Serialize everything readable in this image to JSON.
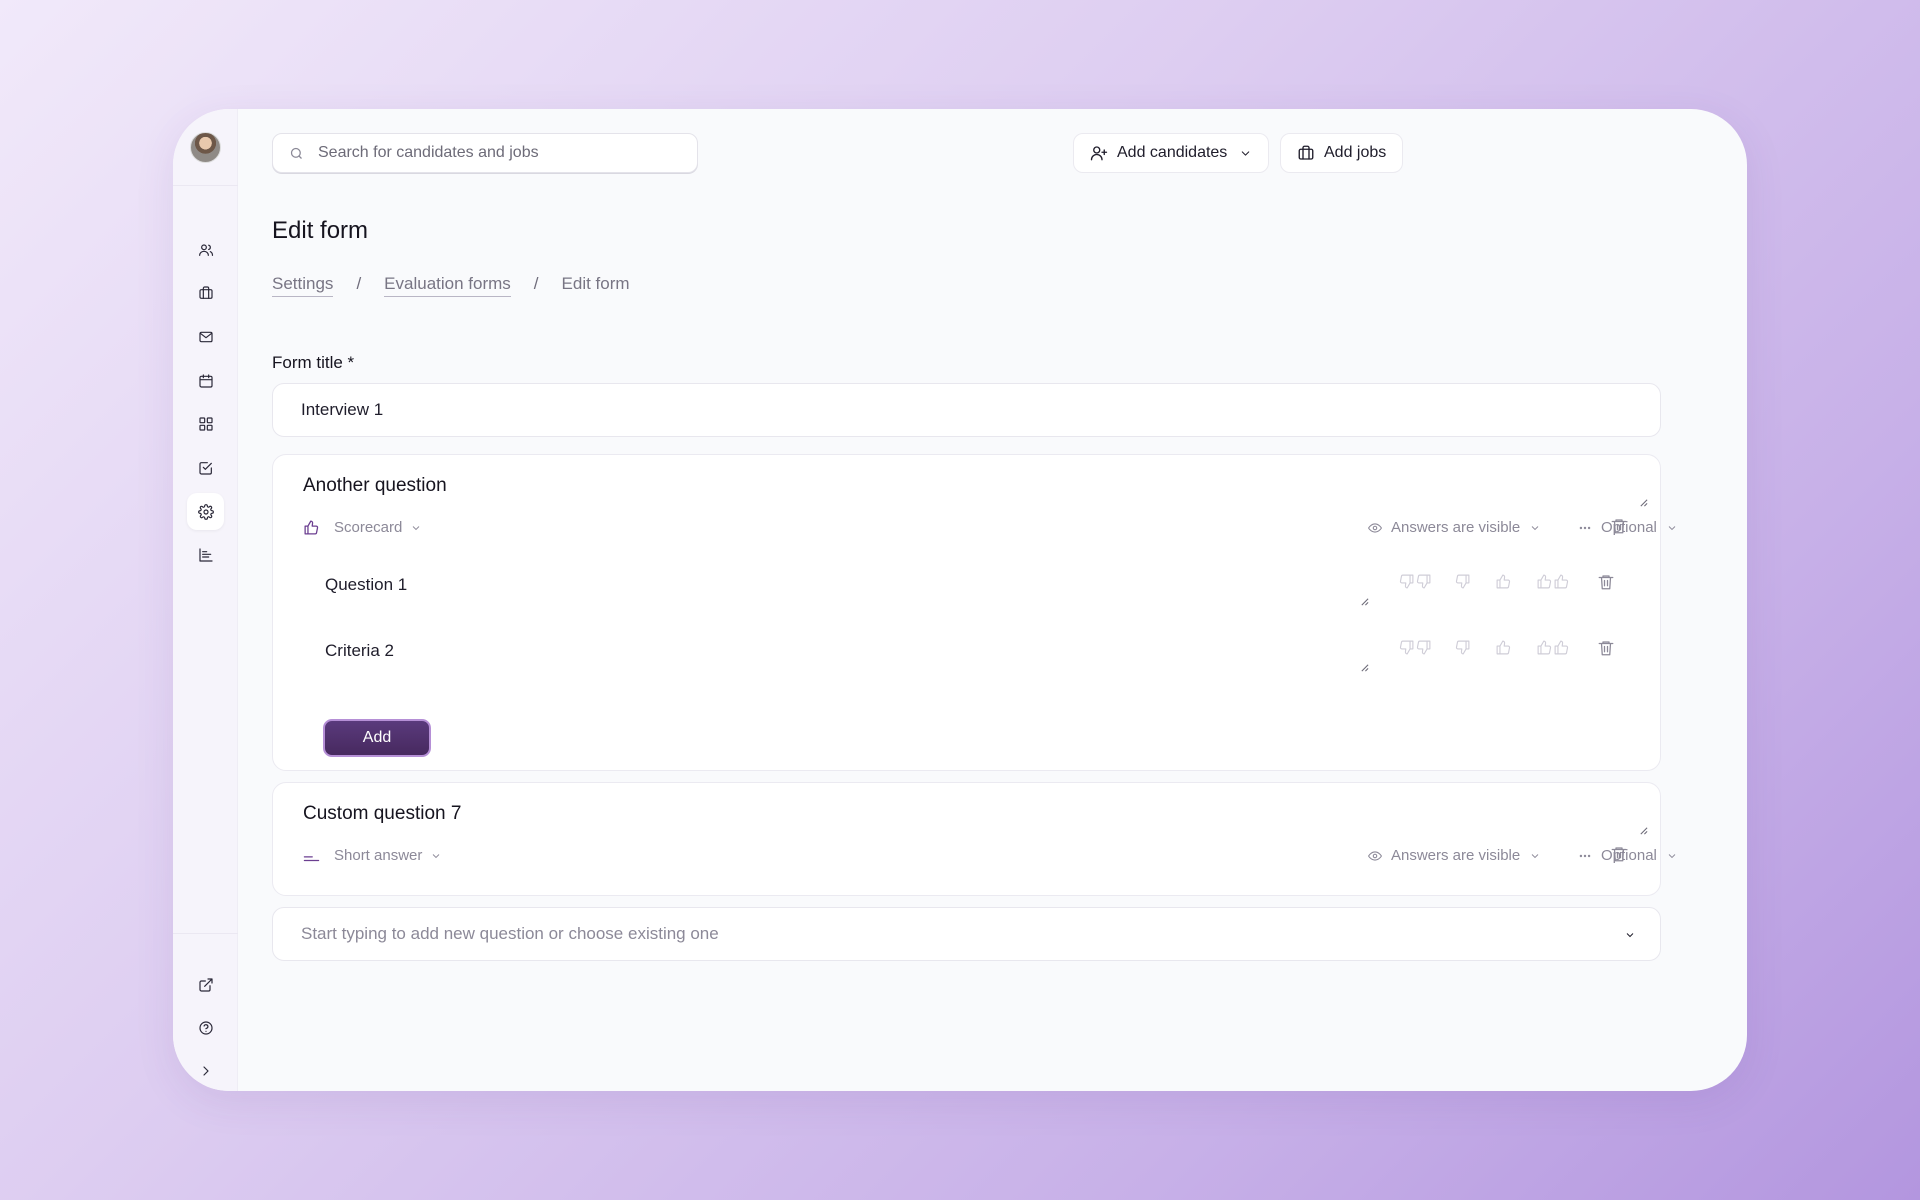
{
  "search": {
    "placeholder": "Search for candidates and jobs"
  },
  "header": {
    "add_candidates_label": "Add candidates",
    "add_jobs_label": "Add jobs"
  },
  "page": {
    "title": "Edit form",
    "breadcrumb": [
      {
        "label": "Settings"
      },
      {
        "label": "Evaluation forms"
      },
      {
        "label": "Edit form"
      }
    ],
    "breadcrumb_separator": "/"
  },
  "sidebar": {
    "items": [
      {
        "icon": "users-icon"
      },
      {
        "icon": "briefcase-icon"
      },
      {
        "icon": "mail-icon"
      },
      {
        "icon": "calendar-icon"
      },
      {
        "icon": "grid-icon"
      },
      {
        "icon": "task-check-icon"
      },
      {
        "icon": "settings-gear-icon",
        "active": true
      },
      {
        "icon": "chart-icon"
      }
    ],
    "bottom_items": [
      {
        "icon": "external-link-icon"
      },
      {
        "icon": "help-icon"
      },
      {
        "icon": "expand-chevron-icon"
      }
    ]
  },
  "form": {
    "title_label": "Form title *",
    "title_value": "Interview 1",
    "questions": [
      {
        "title": "Another question",
        "type": "Scorecard",
        "visibility": "Answers are visible",
        "requirement": "Optional",
        "criteria": [
          {
            "name": "Question 1"
          },
          {
            "name": "Criteria 2"
          }
        ],
        "add_label": "Add"
      },
      {
        "title": "Custom question 7",
        "type": "Short answer",
        "visibility": "Answers are visible",
        "requirement": "Optional"
      }
    ],
    "new_question_placeholder": "Start typing to add new question or choose existing one"
  },
  "colors": {
    "accent": "#5a3a7c",
    "accent_border": "#b58fd6",
    "muted_text": "#8c8998"
  }
}
